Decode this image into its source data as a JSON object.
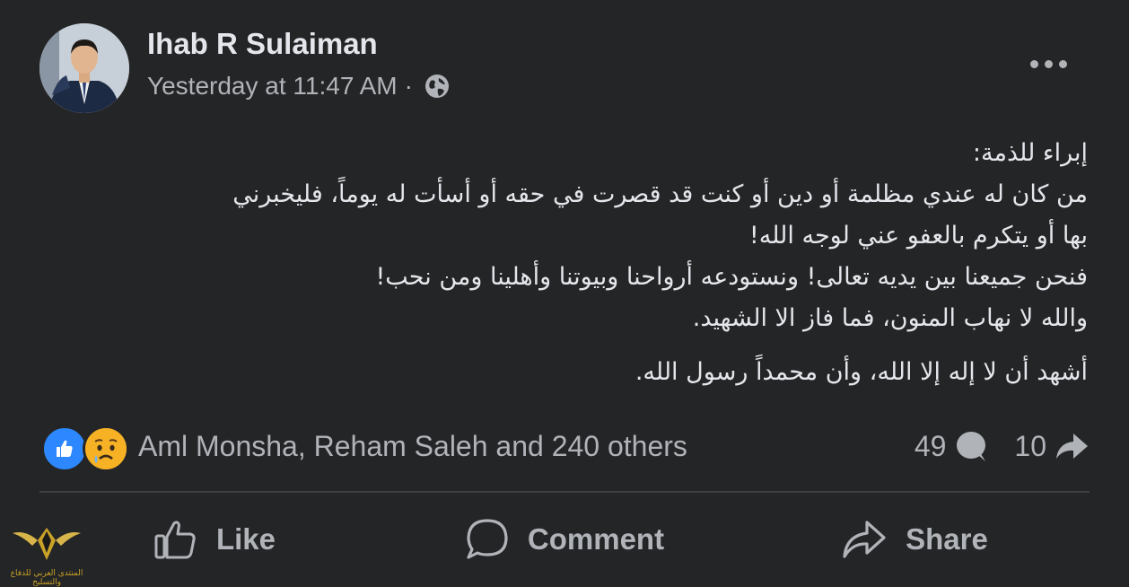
{
  "post": {
    "author": "Ihab R Sulaiman",
    "timestamp": "Yesterday at 11:47 AM",
    "separator": "·",
    "privacy_icon": "globe-icon",
    "body": {
      "paragraph1": [
        "إبراء للذمة:",
        "من كان له عندي مظلمة أو دين أو كنت قد قصرت في حقه أو أسأت له يوماً، فليخبرني",
        "بها أو يتكرم بالعفو عني لوجه الله!",
        "فنحن جميعنا بين يديه تعالى! ونستودعه أرواحنا وبيوتنا وأهلينا ومن نحب!",
        "والله لا نهاب المنون، فما فاز الا الشهيد."
      ],
      "paragraph2": "أشهد أن لا إله إلا الله، وأن محمداً رسول الله."
    }
  },
  "reactions": {
    "types": [
      "like-icon",
      "sad-icon"
    ],
    "summary": "Aml Monsha, Reham Saleh and 240 others",
    "comments_count": "49",
    "shares_count": "10"
  },
  "actions": {
    "like_label": "Like",
    "comment_label": "Comment",
    "share_label": "Share"
  },
  "watermark": {
    "text": "المنتدى العربي للدفاع والتسليح"
  },
  "colors": {
    "background": "#242526",
    "primary_text": "#e4e6eb",
    "secondary_text": "#b0b3b8",
    "like_blue": "#2d88ff",
    "sad_yellow": "#f7b125"
  }
}
